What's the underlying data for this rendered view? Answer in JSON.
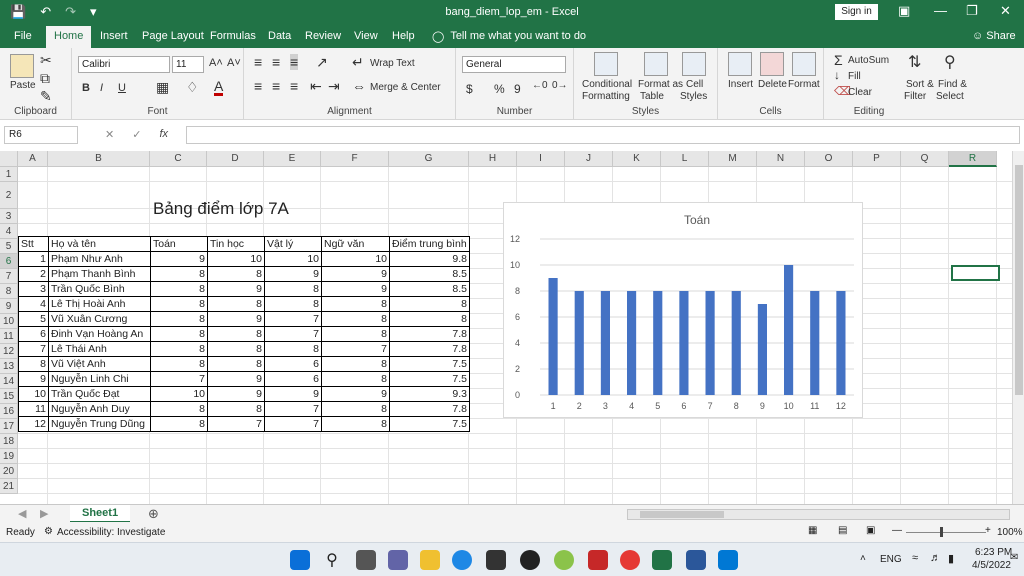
{
  "window": {
    "title": "bang_diem_lop_em  -  Excel",
    "signin": "Sign in"
  },
  "tabs": [
    "File",
    "Home",
    "Insert",
    "Page Layout",
    "Formulas",
    "Data",
    "Review",
    "View",
    "Help"
  ],
  "tell_me": "Tell me what you want to do",
  "share": "Share",
  "ribbon": {
    "clipboard": {
      "label": "Clipboard",
      "paste": "Paste"
    },
    "font": {
      "label": "Font",
      "name": "Calibri",
      "size": "11",
      "bold": "B",
      "italic": "I",
      "underline": "U"
    },
    "alignment": {
      "label": "Alignment",
      "wrap": "Wrap Text",
      "merge": "Merge & Center"
    },
    "number": {
      "label": "Number",
      "format": "General",
      "currency": "$",
      "percent": "%",
      "comma": "9"
    },
    "styles": {
      "label": "Styles",
      "cond1": "Conditional",
      "cond2": "Formatting",
      "fmt1": "Format as",
      "fmt2": "Table",
      "cell1": "Cell",
      "cell2": "Styles"
    },
    "cells": {
      "label": "Cells",
      "insert": "Insert",
      "delete": "Delete",
      "format": "Format"
    },
    "editing": {
      "label": "Editing",
      "autosum": "AutoSum",
      "fill": "Fill",
      "clear": "Clear",
      "sort1": "Sort &",
      "sort2": "Filter",
      "find1": "Find &",
      "find2": "Select"
    }
  },
  "formula": {
    "namebox": "R6",
    "fx": "fx",
    "value": ""
  },
  "columns": [
    "A",
    "B",
    "C",
    "D",
    "E",
    "F",
    "G",
    "H",
    "I",
    "J",
    "K",
    "L",
    "M",
    "N",
    "O",
    "P",
    "Q",
    "R"
  ],
  "rows": [
    "1",
    "2",
    "3",
    "4",
    "5",
    "6",
    "7",
    "8",
    "9",
    "10",
    "11",
    "12",
    "13",
    "14",
    "15",
    "16",
    "17",
    "18",
    "19",
    "20",
    "21"
  ],
  "sheet_title": "Bảng điểm lớp 7A",
  "table": {
    "headers": [
      "Stt",
      "Họ và tên",
      "Toán",
      "Tin học",
      "Vật lý",
      "Ngữ văn",
      "Điểm trung bình"
    ],
    "rows": [
      [
        "1",
        "Phạm Như Anh",
        "9",
        "10",
        "10",
        "10",
        "9.8"
      ],
      [
        "2",
        "Phạm Thanh Bình",
        "8",
        "8",
        "9",
        "9",
        "8.5"
      ],
      [
        "3",
        "Trần Quốc Bình",
        "8",
        "9",
        "8",
        "9",
        "8.5"
      ],
      [
        "4",
        "Lê Thị Hoài Anh",
        "8",
        "8",
        "8",
        "8",
        "8"
      ],
      [
        "5",
        "Vũ Xuân Cương",
        "8",
        "9",
        "7",
        "8",
        "8"
      ],
      [
        "6",
        "Đinh Vạn Hoàng An",
        "8",
        "8",
        "7",
        "8",
        "7.8"
      ],
      [
        "7",
        "Lê Thái Anh",
        "8",
        "8",
        "8",
        "7",
        "7.8"
      ],
      [
        "8",
        "Vũ Việt Anh",
        "8",
        "8",
        "6",
        "8",
        "7.5"
      ],
      [
        "9",
        "Nguyễn Linh Chi",
        "7",
        "9",
        "6",
        "8",
        "7.5"
      ],
      [
        "10",
        "Trần Quốc Đạt",
        "10",
        "9",
        "9",
        "9",
        "9.3"
      ],
      [
        "11",
        "Nguyễn Anh Duy",
        "8",
        "8",
        "7",
        "8",
        "7.8"
      ],
      [
        "12",
        "Nguyễn Trung Dũng",
        "8",
        "7",
        "7",
        "8",
        "7.5"
      ]
    ]
  },
  "chart_data": {
    "type": "bar",
    "title": "Toán",
    "categories": [
      "1",
      "2",
      "3",
      "4",
      "5",
      "6",
      "7",
      "8",
      "9",
      "10",
      "11",
      "12"
    ],
    "values": [
      9,
      8,
      8,
      8,
      8,
      8,
      8,
      8,
      7,
      10,
      8,
      8
    ],
    "yticks": [
      "0",
      "2",
      "4",
      "6",
      "8",
      "10",
      "12"
    ],
    "ylim": [
      0,
      12
    ],
    "grid": true,
    "color": "#4472c4"
  },
  "sheet_tab": "Sheet1",
  "status": {
    "ready": "Ready",
    "accessibility": "Accessibility: Investigate",
    "zoom": "100%"
  },
  "taskbar": {
    "lang": "ENG",
    "time": "6:23 PM",
    "date": "4/5/2022"
  },
  "colors": {
    "excel_green": "#217346",
    "bar": "#4472c4"
  }
}
